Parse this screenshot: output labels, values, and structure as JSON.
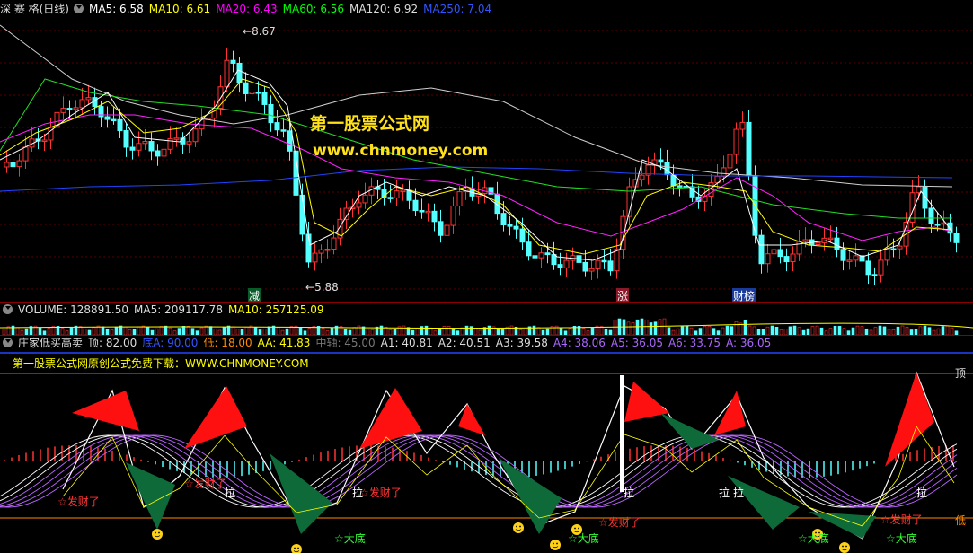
{
  "main_panel": {
    "title": "深 赛 格(日线)",
    "ma": [
      {
        "label": "MA5:",
        "value": "6.58",
        "color": "#ffffff"
      },
      {
        "label": "MA10:",
        "value": "6.61",
        "color": "#ffff00"
      },
      {
        "label": "MA20:",
        "value": "6.43",
        "color": "#ff00ff"
      },
      {
        "label": "MA60:",
        "value": "6.56",
        "color": "#00ff00"
      },
      {
        "label": "MA120:",
        "value": "6.92",
        "color": "#dddddd"
      },
      {
        "label": "MA250:",
        "value": "7.04",
        "color": "#3355ff"
      }
    ],
    "high_label": "8.67",
    "low_label": "5.88",
    "marks": [
      "减",
      "涨",
      "财榜"
    ],
    "watermark_1": "第一股票公式网",
    "watermark_2": "www.chnmoney.com"
  },
  "volume_panel": {
    "items": [
      {
        "label": "VOLUME:",
        "value": "128891.50",
        "color": "#dddddd"
      },
      {
        "label": "MA5:",
        "value": "209117.78",
        "color": "#dddddd"
      },
      {
        "label": "MA10:",
        "value": "257125.09",
        "color": "#ffff00"
      }
    ]
  },
  "indicator_panel": {
    "items": [
      {
        "label": "庄家低买高卖",
        "value": "",
        "color": "#dddddd"
      },
      {
        "label": "顶:",
        "value": "82.00",
        "color": "#dddddd"
      },
      {
        "label": "底A:",
        "value": "90.00",
        "color": "#3355ff"
      },
      {
        "label": "低:",
        "value": "18.00",
        "color": "#ff8800"
      },
      {
        "label": "AA:",
        "value": "41.83",
        "color": "#ffff00"
      },
      {
        "label": "中轴:",
        "value": "45.00",
        "color": "#777777"
      },
      {
        "label": "A1:",
        "value": "40.81",
        "color": "#dddddd"
      },
      {
        "label": "A2:",
        "value": "40.51",
        "color": "#dddddd"
      },
      {
        "label": "A3:",
        "value": "39.58",
        "color": "#dddddd"
      },
      {
        "label": "A4:",
        "value": "38.06",
        "color": "#aa66ff"
      },
      {
        "label": "A5:",
        "value": "36.05",
        "color": "#aa66ff"
      },
      {
        "label": "A6:",
        "value": "33.75",
        "color": "#aa66ff"
      },
      {
        "label": "A:",
        "value": "36.05",
        "color": "#aa66ff"
      }
    ],
    "promo": "第一股票公式网原创公式免费下载：WWW.CHNMONEY.COM",
    "top_label": "顶",
    "bottom_label": "低",
    "fa_cai": "☆发财了",
    "la": "拉",
    "da_di": "☆大底"
  }
}
